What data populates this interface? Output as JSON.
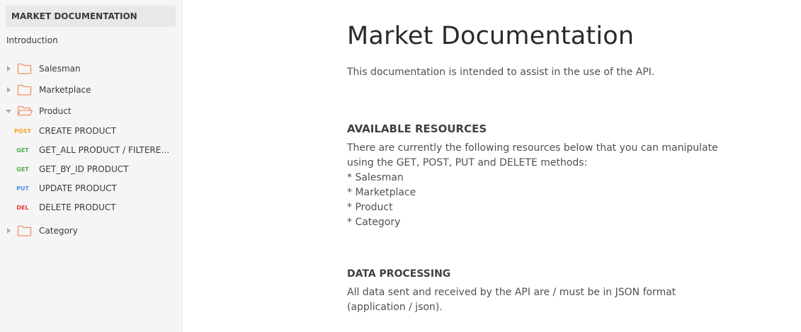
{
  "sidebar": {
    "collection_title": "MARKET DOCUMENTATION",
    "introduction": "Introduction",
    "folders": [
      {
        "name": "Salesman",
        "expanded": false
      },
      {
        "name": "Marketplace",
        "expanded": false
      },
      {
        "name": "Product",
        "expanded": true
      },
      {
        "name": "Category",
        "expanded": false
      }
    ],
    "product_requests": [
      {
        "method": "POST",
        "label": "CREATE PRODUCT"
      },
      {
        "method": "GET",
        "label": "GET_ALL PRODUCT / FILTERED PRODUCT"
      },
      {
        "method": "GET",
        "label": "GET_BY_ID PRODUCT"
      },
      {
        "method": "PUT",
        "label": "UPDATE PRODUCT"
      },
      {
        "method": "DEL",
        "label": "DELETE PRODUCT"
      }
    ]
  },
  "colors": {
    "post": "#f5a623",
    "get": "#4caf50",
    "put": "#4a90e2",
    "del": "#e53935",
    "folder_icon": "#f0926b"
  },
  "icons": {
    "folder": "folder-icon",
    "folder_open": "folder-open-icon",
    "caret": "caret-icon"
  },
  "doc": {
    "title": "Market Documentation",
    "intro": "This documentation is intended to assist in the use of the API.",
    "available_resources": {
      "heading": "AVAILABLE RESOURCES",
      "lines": [
        "There are currently the following resources below that you can manipulate",
        "using the GET, POST, PUT and DELETE methods:",
        "* Salesman",
        "* Marketplace",
        "* Product",
        "* Category"
      ]
    },
    "data_processing": {
      "heading": "DATA PROCESSING",
      "lines": [
        "All data sent and received by the API are / must be in JSON format",
        "(application / json)."
      ]
    }
  }
}
